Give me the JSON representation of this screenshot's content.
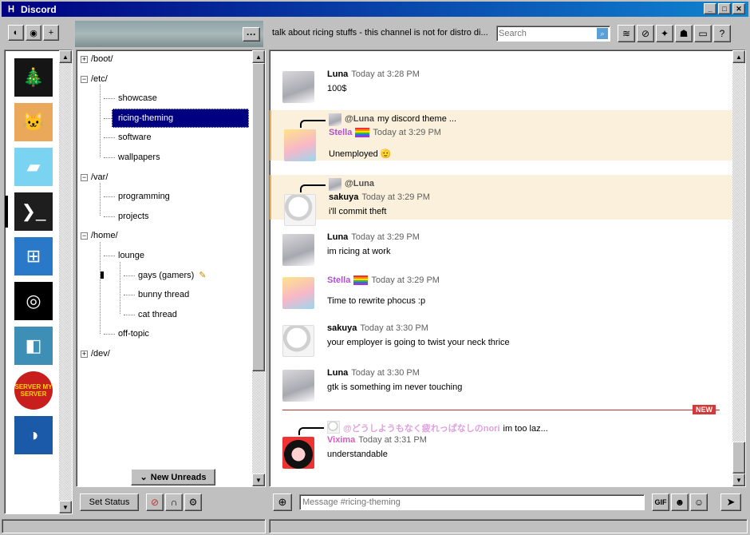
{
  "window": {
    "title": "Discord",
    "app_icon": "discord-logo-icon",
    "controls": [
      "minimize",
      "maximize",
      "close"
    ]
  },
  "toolbar": {
    "left_buttons": [
      {
        "name": "discord-home-icon",
        "glyph": "◐"
      },
      {
        "name": "explore-icon",
        "glyph": "◉"
      },
      {
        "name": "add-icon",
        "glyph": "+"
      }
    ],
    "banner_more": "···",
    "topic": "talk about ricing stuffs - this channel is not for distro di...",
    "search_placeholder": "Search",
    "right_buttons": [
      "threads-icon",
      "mute-icon",
      "pin-icon",
      "members-icon",
      "inbox-icon",
      "help-icon"
    ]
  },
  "servers": [
    {
      "name": "christmas-tree-server",
      "glyph": "🎄",
      "bg": "#151515"
    },
    {
      "name": "cat-server",
      "glyph": "🐱",
      "bg": "#e9a85a"
    },
    {
      "name": "colorful-server",
      "glyph": "▰",
      "bg": "#7ad3f0"
    },
    {
      "name": "terminal-server",
      "glyph": "❯_",
      "bg": "#1e1e1e",
      "active": true
    },
    {
      "name": "windows-server",
      "glyph": "⊞",
      "bg": "#2a78c8"
    },
    {
      "name": "planet-server",
      "glyph": "◎",
      "bg": "#000000"
    },
    {
      "name": "coffee-server",
      "glyph": "◧",
      "bg": "#3d8fb5"
    },
    {
      "name": "server-my-server",
      "glyph": "SERVER MY SERVER",
      "bg": "#c81e1e"
    },
    {
      "name": "steam-server",
      "glyph": "◑",
      "bg": "#1b5aa8"
    }
  ],
  "channels": {
    "folders": [
      {
        "label": "/boot/",
        "expanded": false
      },
      {
        "label": "/etc/",
        "expanded": true,
        "children": [
          "showcase",
          "ricing-theming",
          "software",
          "wallpapers"
        ]
      },
      {
        "label": "/var/",
        "expanded": true,
        "children": [
          "programming",
          "projects"
        ]
      },
      {
        "label": "/home/",
        "expanded": true,
        "children": [
          "lounge",
          "off-topic"
        ],
        "lounge_threads": [
          "gays (gamers)",
          "bunny thread",
          "cat thread"
        ]
      },
      {
        "label": "/dev/",
        "expanded": false
      }
    ],
    "selected": "ricing-theming",
    "new_unreads": "New Unreads"
  },
  "messages": [
    {
      "author": "Luna",
      "time": "Today at 3:28 PM",
      "text": "100$",
      "avatar": "luna"
    },
    {
      "author": "Stella",
      "time": "Today at 3:29 PM",
      "text": "Unemployed 🫡",
      "avatar": "stella",
      "reply_to": "@Luna",
      "reply_text": "my discord theme ...",
      "mention": true
    },
    {
      "author": "sakuya",
      "time": "Today at 3:29 PM",
      "text": "i'll commit theft",
      "avatar": "sakuya",
      "reply_to": "@Luna",
      "reply_text": "",
      "mention": true
    },
    {
      "author": "Luna",
      "time": "Today at 3:29 PM",
      "text": "im ricing at work",
      "avatar": "luna"
    },
    {
      "author": "Stella",
      "time": "Today at 3:29 PM",
      "text": "Time to rewrite phocus :p",
      "avatar": "stella"
    },
    {
      "author": "sakuya",
      "time": "Today at 3:30 PM",
      "text": "your employer is going to twist your neck thrice",
      "avatar": "sakuya"
    },
    {
      "author": "Luna",
      "time": "Today at 3:30 PM",
      "text": "gtk is something im never touching",
      "avatar": "luna"
    },
    {
      "author": "Vixima",
      "time": "Today at 3:31 PM",
      "text": "understandable",
      "avatar": "vixima",
      "reply_to": "@どうしようもなく疲れっぱなしのnori",
      "reply_text": "im too laz..."
    }
  ],
  "new_badge": "NEW",
  "user_bar": {
    "set_status": "Set Status",
    "controls": [
      "mute-mic-icon",
      "headphones-icon",
      "settings-icon"
    ]
  },
  "composer": {
    "placeholder": "Message #ricing-theming",
    "tools": [
      "GIF",
      "sticker-icon",
      "emoji-icon"
    ],
    "send": "➤"
  },
  "colors": {
    "selection": "#000080",
    "stella": "#b050d0",
    "vixima": "#d060c0",
    "mention_bg": "#faf0dc",
    "new_red": "#d03a3a"
  }
}
